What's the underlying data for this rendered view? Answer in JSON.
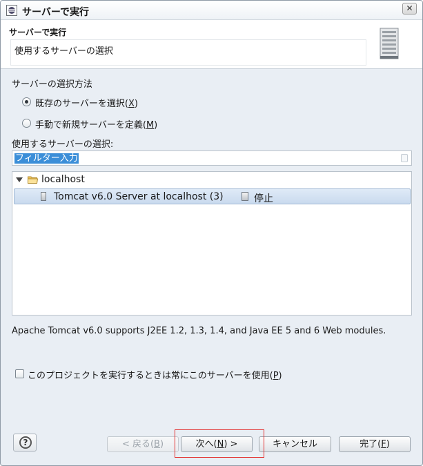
{
  "window": {
    "title": "サーバーで実行",
    "close_glyph": "✕"
  },
  "banner": {
    "title": "サーバーで実行",
    "message": "使用するサーバーの選択"
  },
  "method": {
    "label": "サーバーの選択方法",
    "options": [
      {
        "text": "既存のサーバーを選択(",
        "mnemonic": "X",
        "suffix": ")",
        "checked": true
      },
      {
        "text": "手動で新規サーバーを定義(",
        "mnemonic": "M",
        "suffix": ")",
        "checked": false
      }
    ]
  },
  "select_label": "使用するサーバーの選択:",
  "filter": {
    "value": "フィルター入力"
  },
  "tree": {
    "root": "localhost",
    "servers": [
      {
        "name": "Tomcat v6.0 Server at localhost (3)",
        "state": "停止"
      }
    ]
  },
  "description": "Apache Tomcat v6.0 supports J2EE 1.2, 1.3, 1.4, and Java EE 5 and 6 Web modules.",
  "always_use": {
    "text": "このプロジェクトを実行するときは常にこのサーバーを使用(",
    "mnemonic": "P",
    "suffix": ")",
    "checked": false
  },
  "buttons": {
    "help": "?",
    "back": {
      "text": "< 戻る(",
      "mnemonic": "B",
      "suffix": ")",
      "enabled": false
    },
    "next": {
      "text": "次へ(",
      "mnemonic": "N",
      "suffix": ") >",
      "enabled": true
    },
    "cancel": {
      "text": "キャンセル",
      "enabled": true
    },
    "finish": {
      "text": "完了(",
      "mnemonic": "F",
      "suffix": ")",
      "enabled": true
    }
  },
  "colors": {
    "selection": "#3b8ed8",
    "highlight_box": "#e23030",
    "dialog_bg": "#e9eef4"
  }
}
